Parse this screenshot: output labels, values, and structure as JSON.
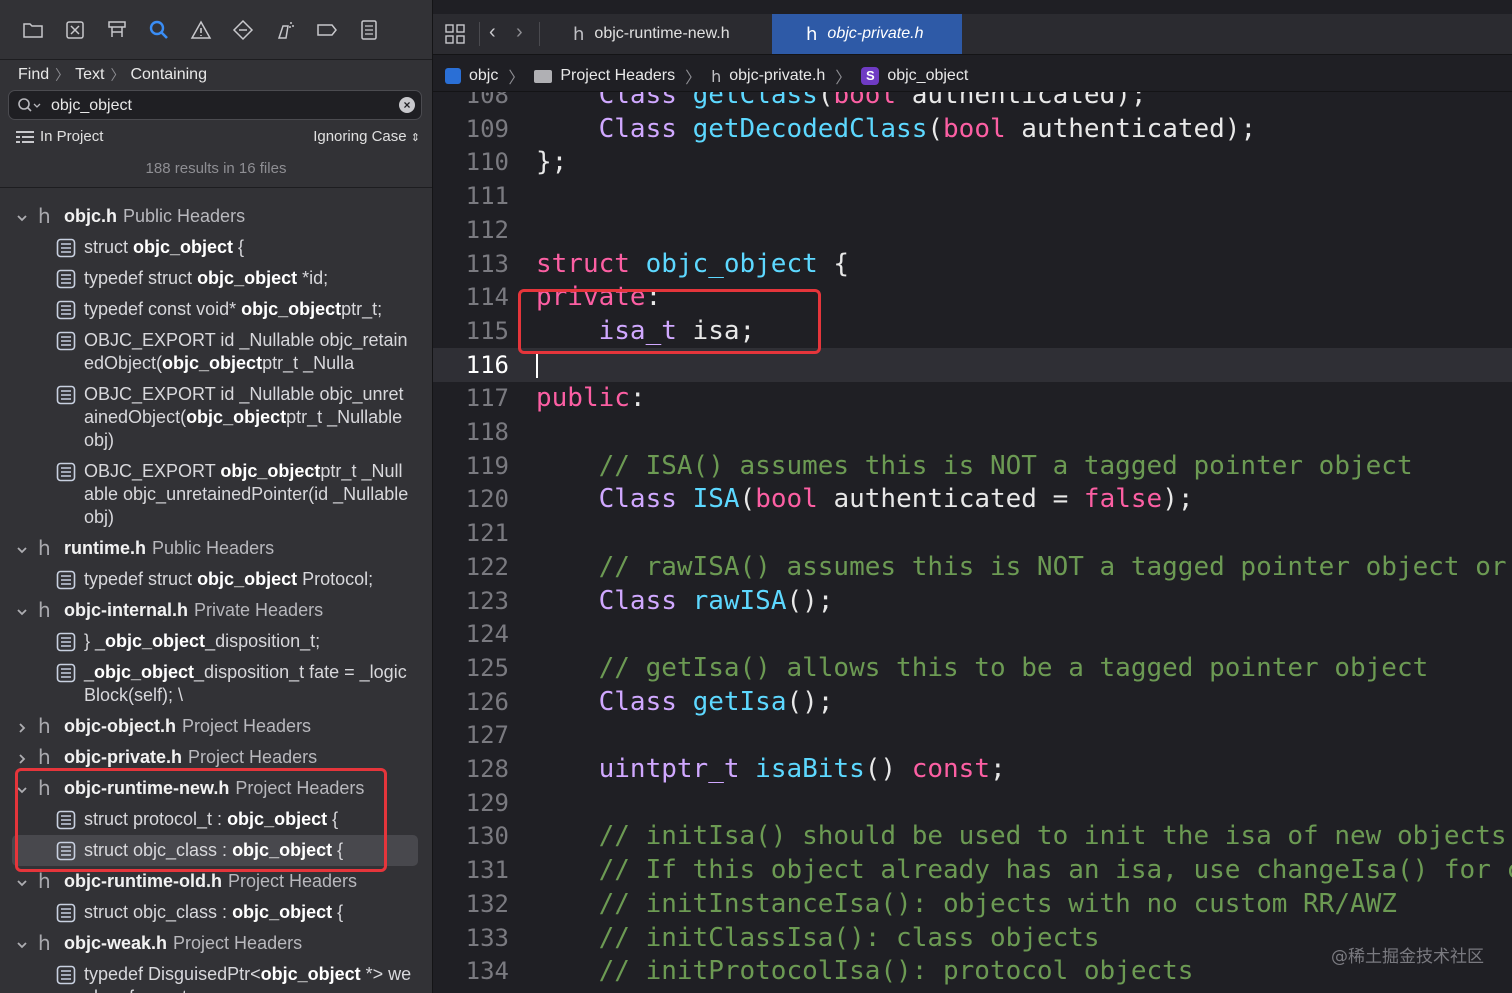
{
  "navigator": {
    "toolbar_icons": [
      "folder-icon",
      "source-control-icon",
      "symbol-hierarchy-icon",
      "find-icon",
      "issue-warning-icon",
      "test-diamond-icon",
      "debug-spray-icon",
      "breakpoint-icon",
      "report-icon"
    ],
    "find_mode": [
      "Find",
      "Text",
      "Containing"
    ],
    "search_value": "objc_object",
    "scope": "In Project",
    "case_mode": "Ignoring Case",
    "summary": "188 results in 16 files",
    "files": [
      {
        "name": "objc.h",
        "group": "Public Headers",
        "expanded": true,
        "matches": [
          {
            "pre": "struct ",
            "hit": "objc_object",
            "post": " {"
          },
          {
            "pre": "typedef struct ",
            "hit": "objc_object",
            "post": " *id;"
          },
          {
            "pre": "typedef const void* ",
            "hit": "objc_object",
            "post": "ptr_t;"
          },
          {
            "pre": "OBJC_EXPORT id _Nullable objc_retainedObject(",
            "hit": "objc_object",
            "post": "ptr_t _Nulla"
          },
          {
            "pre": "OBJC_EXPORT id _Nullable objc_unretainedObject(",
            "hit": "objc_object",
            "post": "ptr_t _Nullable obj)"
          },
          {
            "pre": "OBJC_EXPORT ",
            "hit": "objc_object",
            "post": "ptr_t _Nullable objc_unretainedPointer(id _Nullable obj)"
          }
        ]
      },
      {
        "name": "runtime.h",
        "group": "Public Headers",
        "expanded": true,
        "matches": [
          {
            "pre": "typedef struct ",
            "hit": "objc_object",
            "post": " Protocol;"
          }
        ]
      },
      {
        "name": "objc-internal.h",
        "group": "Private Headers",
        "expanded": true,
        "matches": [
          {
            "pre": "} _",
            "hit": "objc_object",
            "post": "_disposition_t;"
          },
          {
            "pre": "_",
            "hit": "objc_object",
            "post": "_disposition_t fate = _logicBlock(self);                 \\"
          }
        ]
      },
      {
        "name": "objc-object.h",
        "group": "Project Headers",
        "expanded": false,
        "matches": []
      },
      {
        "name": "objc-private.h",
        "group": "Project Headers",
        "expanded": false,
        "matches": []
      },
      {
        "name": "objc-runtime-new.h",
        "group": "Project Headers",
        "expanded": true,
        "matches": [
          {
            "pre": "struct protocol_t : ",
            "hit": "objc_object",
            "post": " {"
          },
          {
            "pre": "struct objc_class : ",
            "hit": "objc_object",
            "post": " {",
            "selected": true
          }
        ]
      },
      {
        "name": "objc-runtime-old.h",
        "group": "Project Headers",
        "expanded": true,
        "matches": [
          {
            "pre": "struct objc_class : ",
            "hit": "objc_object",
            "post": " {"
          }
        ]
      },
      {
        "name": "objc-weak.h",
        "group": "Project Headers",
        "expanded": true,
        "matches": [
          {
            "pre": "typedef DisguisedPtr<",
            "hit": "objc_object",
            "post": " *> weak_referrer_t;"
          }
        ]
      }
    ]
  },
  "editor": {
    "tabs": [
      {
        "label": "objc-runtime-new.h",
        "active": false
      },
      {
        "label": "objc-private.h",
        "active": true
      }
    ],
    "breadcrumb": [
      "objc",
      "Project Headers",
      "objc-private.h",
      "objc_object"
    ],
    "current_line": 116,
    "lines": [
      {
        "n": "108",
        "t": "    Class getClass(bool authenticated);"
      },
      {
        "n": "109",
        "t": "    Class getDecodedClass(bool authenticated);"
      },
      {
        "n": "110",
        "t": "};"
      },
      {
        "n": "111",
        "t": ""
      },
      {
        "n": "112",
        "t": ""
      },
      {
        "n": "113",
        "t": "struct objc_object {"
      },
      {
        "n": "114",
        "t": "private:"
      },
      {
        "n": "115",
        "t": "    isa_t isa;"
      },
      {
        "n": "116",
        "t": ""
      },
      {
        "n": "117",
        "t": "public:"
      },
      {
        "n": "118",
        "t": ""
      },
      {
        "n": "119",
        "t": "    // ISA() assumes this is NOT a tagged pointer object"
      },
      {
        "n": "120",
        "t": "    Class ISA(bool authenticated = false);"
      },
      {
        "n": "121",
        "t": ""
      },
      {
        "n": "122",
        "t": "    // rawISA() assumes this is NOT a tagged pointer object or"
      },
      {
        "n": "123",
        "t": "    Class rawISA();"
      },
      {
        "n": "124",
        "t": ""
      },
      {
        "n": "125",
        "t": "    // getIsa() allows this to be a tagged pointer object"
      },
      {
        "n": "126",
        "t": "    Class getIsa();"
      },
      {
        "n": "127",
        "t": ""
      },
      {
        "n": "128",
        "t": "    uintptr_t isaBits() const;"
      },
      {
        "n": "129",
        "t": ""
      },
      {
        "n": "130",
        "t": "    // initIsa() should be used to init the isa of new objects"
      },
      {
        "n": "131",
        "t": "    // If this object already has an isa, use changeIsa() for c"
      },
      {
        "n": "132",
        "t": "    // initInstanceIsa(): objects with no custom RR/AWZ"
      },
      {
        "n": "133",
        "t": "    // initClassIsa(): class objects"
      },
      {
        "n": "134",
        "t": "    // initProtocolIsa(): protocol objects"
      }
    ]
  },
  "watermark": "@稀土掘金技术社区",
  "colors": {
    "keyword": "#fc5fa3",
    "type": "#d0a8ff",
    "class": "#5dd8ff",
    "comment": "#6c9a53",
    "function": "#67b7a4",
    "highlight_box": "#e5353b",
    "active_tab": "#2e5aa7"
  }
}
